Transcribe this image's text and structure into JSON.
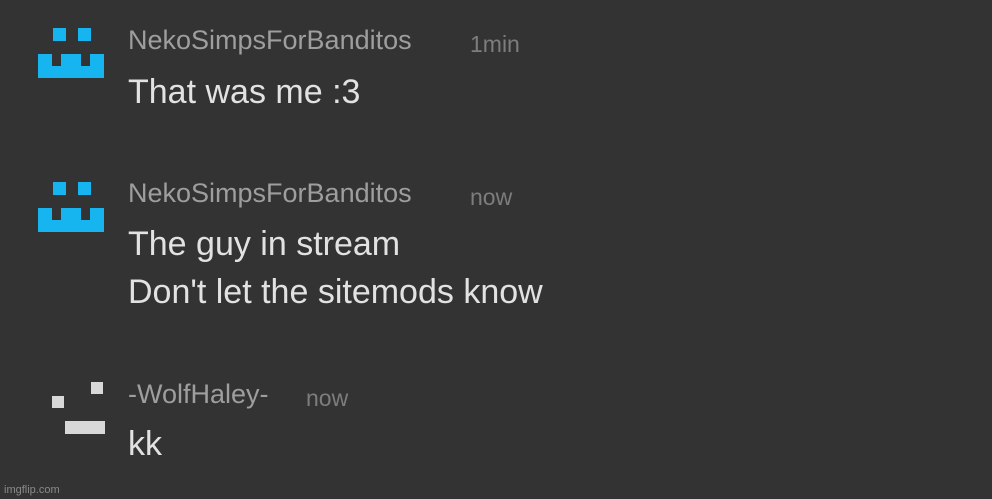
{
  "colors": {
    "background": "#333333",
    "avatar_cyan": "#17b5f0",
    "avatar_light": "#d8d8d8",
    "username": "#9e9e9e",
    "timestamp": "#7d7d7d",
    "message": "#e2e2e2"
  },
  "messages": [
    {
      "username": "NekoSimpsForBanditos",
      "time": "1min",
      "avatar_icon": "cyan-pixel-face-icon",
      "lines": [
        "That was me :3"
      ]
    },
    {
      "username": "NekoSimpsForBanditos",
      "time": "now",
      "avatar_icon": "cyan-pixel-face-icon",
      "lines": [
        "The guy in stream",
        "Don't let the sitemods know"
      ]
    },
    {
      "username": "-WolfHaley-",
      "time": "now",
      "avatar_icon": "gray-pixel-face-icon",
      "lines": [
        "kk"
      ]
    }
  ],
  "watermark": "imgflip.com"
}
